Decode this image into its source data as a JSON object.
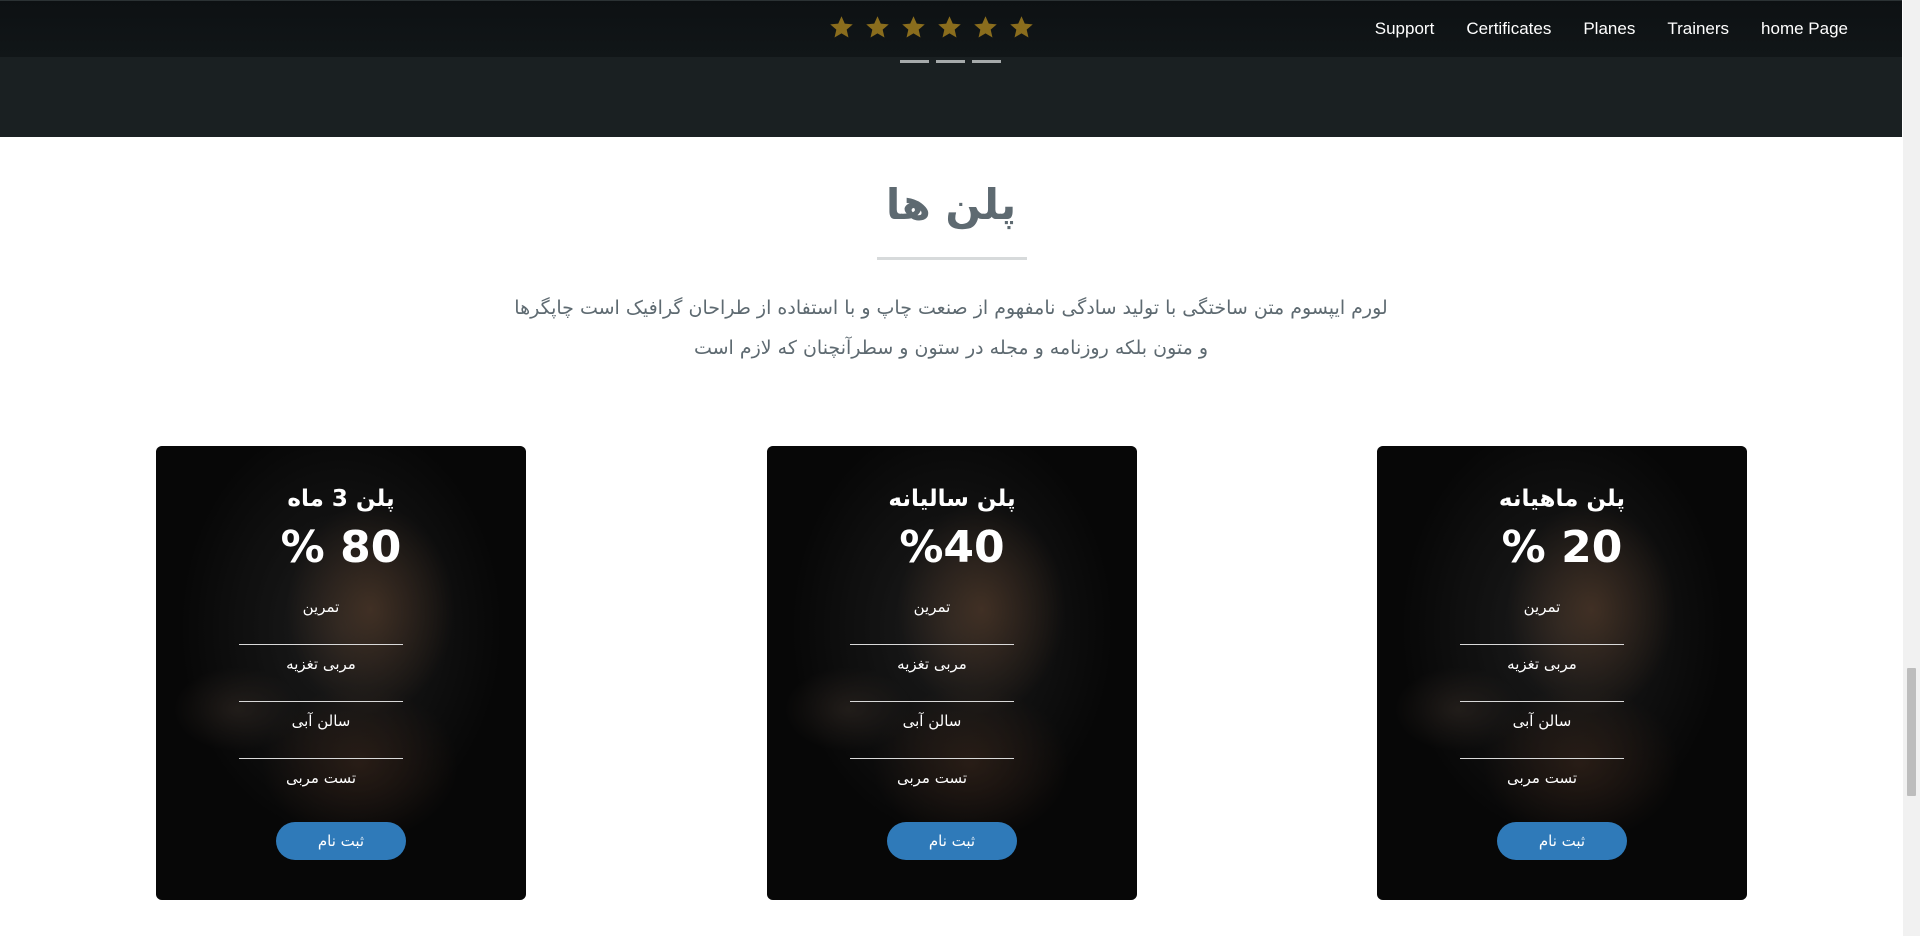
{
  "header": {
    "rating_stars": 6,
    "star_color": "#8a6d1d",
    "nav": [
      {
        "label": "Support"
      },
      {
        "label": "Certificates"
      },
      {
        "label": "Planes"
      },
      {
        "label": "Trainers"
      },
      {
        "label": "home Page"
      }
    ],
    "carousel_indicators": 3
  },
  "plans_section": {
    "title": "پلن ها",
    "description_line1": "لورم ایپسوم متن ساختگی با تولید سادگی نامفهوم از صنعت چاپ و با استفاده از طراحان گرافیک است چاپگرها",
    "description_line2": "و متون بلکه روزنامه و مجله در ستون و سطرآنچنان که لازم است",
    "plans": [
      {
        "name": "پلن 3 ماه",
        "percent": "% 80",
        "features": [
          "تمرین",
          "مربی تغزیه",
          "سالن آبی",
          "تست مربی"
        ],
        "button": "ثبت نام"
      },
      {
        "name": "پلن سالیانه",
        "percent": "%40",
        "features": [
          "تمرین",
          "مربی تغزیه",
          "سالن آبی",
          "تست مربی"
        ],
        "button": "ثبت نام"
      },
      {
        "name": "پلن ماهیانه",
        "percent": "% 20",
        "features": [
          "تمرین",
          "مربی تغزیه",
          "سالن آبی",
          "تست مربی"
        ],
        "button": "ثبت نام"
      }
    ]
  },
  "colors": {
    "nav_bg": "#111618",
    "band_bg": "#1a2022",
    "button_blue": "#2f7ab9",
    "title_gray": "#5e6a71"
  }
}
